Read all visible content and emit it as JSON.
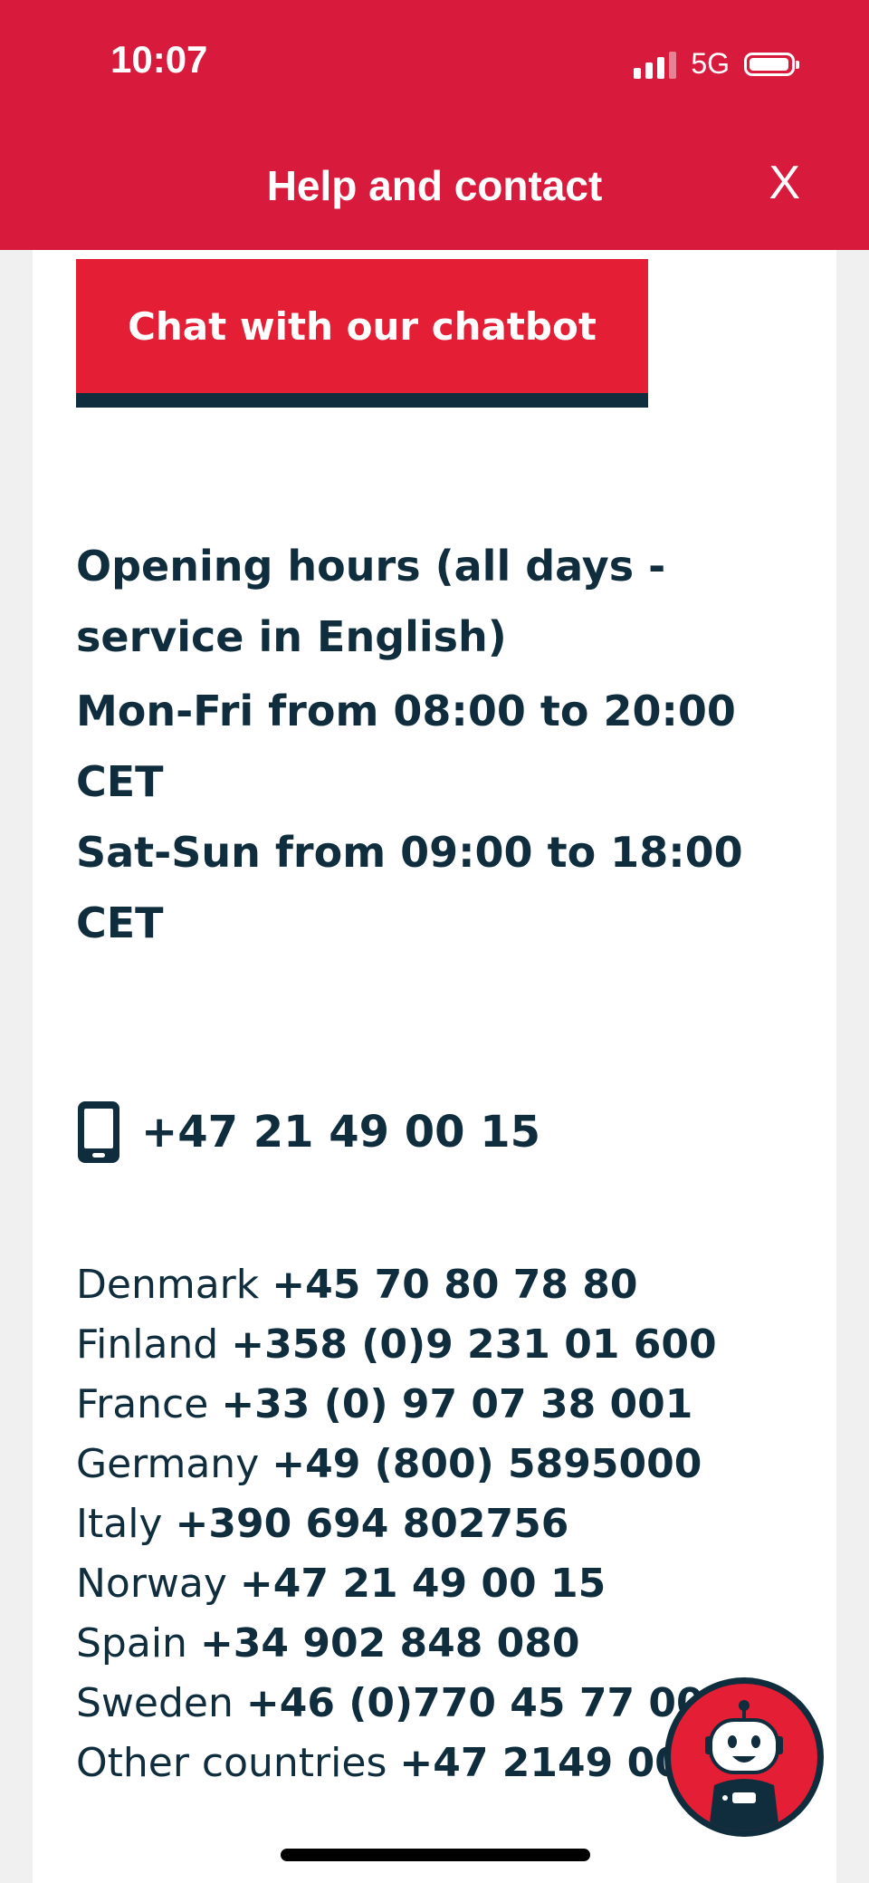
{
  "status_bar": {
    "time": "10:07",
    "network": "5G"
  },
  "header": {
    "title": "Help and contact",
    "close_label": "X"
  },
  "chat_button": {
    "label": "Chat with our chatbot"
  },
  "opening_hours": {
    "title_line1": "Opening hours (all days -",
    "title_line2": "service in English)",
    "weekday_line1": "Mon-Fri from 08:00 to 20:00",
    "weekday_line2": "CET",
    "weekend_line1": "Sat-Sun from 09:00 to 18:00",
    "weekend_line2": "CET"
  },
  "main_phone": {
    "icon": "mobile-phone-icon",
    "number": "+47 21 49 00 15"
  },
  "countries": [
    {
      "name": "Denmark",
      "number": "+45 70 80 78 80"
    },
    {
      "name": "Finland",
      "number": "+358 (0)9 231 01 600"
    },
    {
      "name": "France",
      "number": "+33 (0) 97 07 38 001"
    },
    {
      "name": "Germany",
      "number": "+49 (800) 5895000"
    },
    {
      "name": "Italy",
      "number": "+390 694 802756"
    },
    {
      "name": "Norway",
      "number": "+47 21 49 00 15"
    },
    {
      "name": "Spain",
      "number": "+34 902 848 080"
    },
    {
      "name": "Sweden",
      "number": "+46 (0)770 45 77 00"
    },
    {
      "name": "Other countries",
      "number": "+47 2149 00 15"
    }
  ],
  "chatbot_fab": {
    "icon": "chatbot-robot-icon"
  },
  "colors": {
    "header_red": "#d81b3c",
    "button_red": "#e31e35",
    "navy": "#0f2d3c",
    "card": "#ffffff",
    "page": "#f0f0f0"
  }
}
